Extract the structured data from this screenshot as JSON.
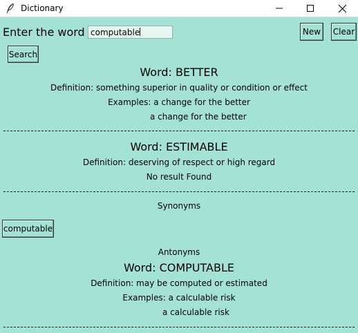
{
  "window": {
    "title": "Dictionary",
    "icon": "feather-icon"
  },
  "form": {
    "label": "Enter the word",
    "input_value": "computable",
    "new_label": "New",
    "clear_label": "Clear",
    "search_label": "Search"
  },
  "results": [
    {
      "word": "Word: BETTER",
      "definition": "Definition:  something superior in quality or condition or effect",
      "examples_label": "Examples:   a change for the better",
      "example2": "a change for the better"
    },
    {
      "word": "Word: ESTIMABLE",
      "definition": "Definition:  deserving of respect or high regard",
      "note": "No result Found"
    },
    {
      "synonyms_label": "Synonyms",
      "synonym_button": "computable",
      "antonyms_label": "Antonyms"
    },
    {
      "word": "Word: COMPUTABLE",
      "definition": "Definition:  may be computed or estimated",
      "examples_label": "Examples:   a calculable risk",
      "example2": "a calculable risk"
    }
  ]
}
